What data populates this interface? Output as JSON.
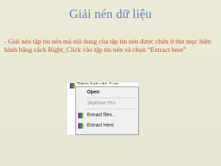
{
  "slide": {
    "title": "Giải nén dữ liệu",
    "body": "- Giải nén tập tin nén mà nội dung của tập tin nén được chứa ở thư mục hiện hành bằng cách Right_Click vào tập tin nén và chọn “Extract here”"
  },
  "screenshot": {
    "file_name": "Tiếng Anh căn 2.rar",
    "file_icon": "winrar-archive-icon",
    "context_menu": [
      {
        "label": "Open",
        "bold": true,
        "disabled": false,
        "icon": ""
      },
      {
        "label": "SkyDrive Pro",
        "bold": false,
        "disabled": true,
        "icon": ""
      },
      {
        "label": "Extract files...",
        "bold": false,
        "disabled": false,
        "icon": "winrar-icon"
      },
      {
        "label": "Extract Here",
        "bold": false,
        "disabled": false,
        "icon": "winrar-icon"
      }
    ]
  },
  "colors": {
    "background": "#e8e6d0",
    "title": "#5a7fb8",
    "body_text": "#d1461f"
  }
}
